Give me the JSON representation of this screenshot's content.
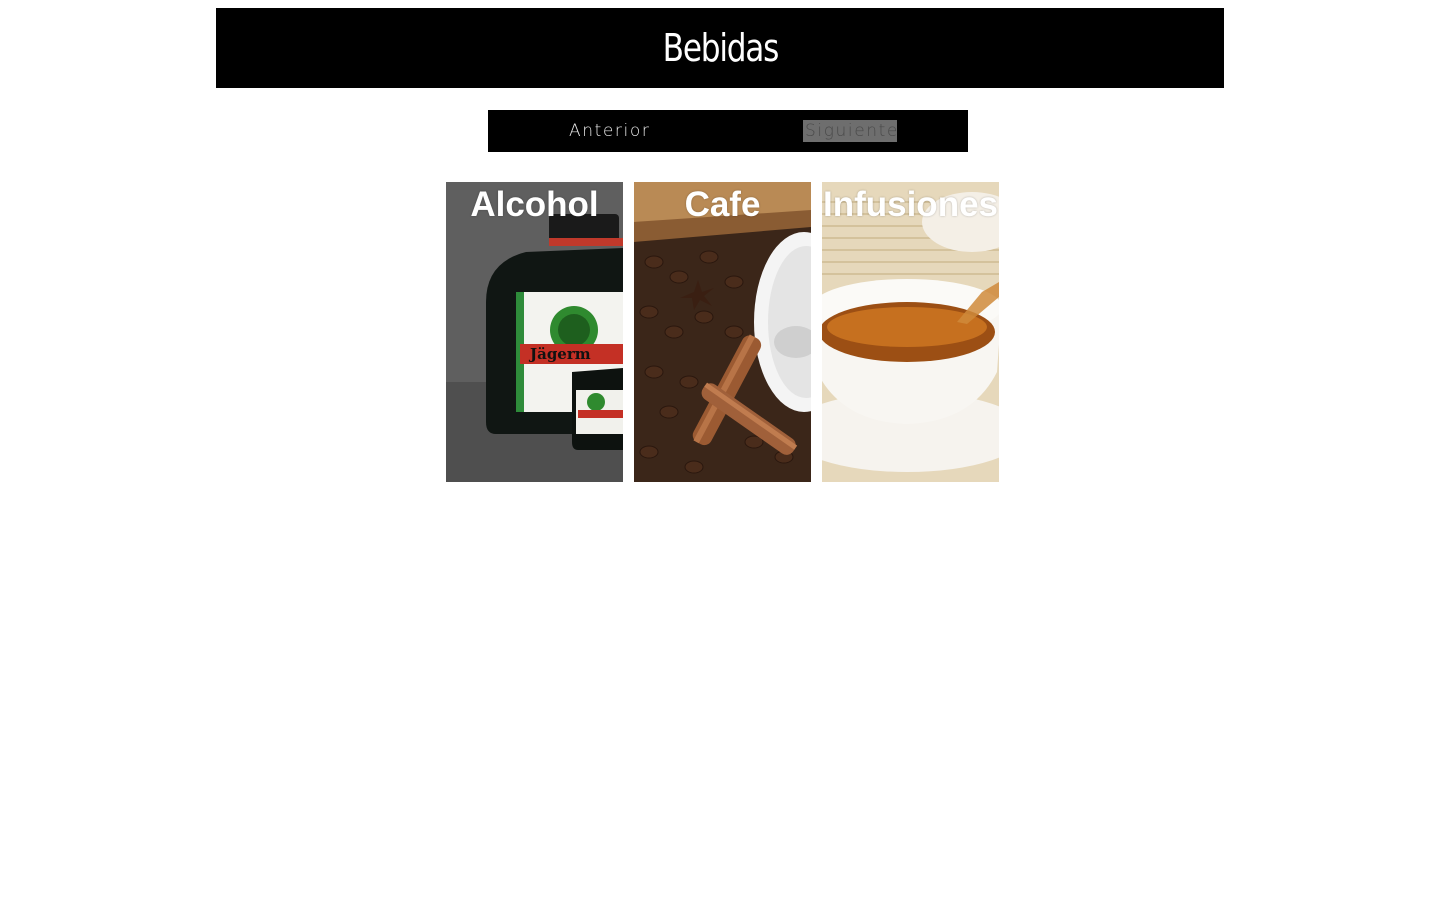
{
  "header": {
    "title": "Bebidas"
  },
  "nav": {
    "prev_label": "Anterior",
    "next_label": "Siguiente"
  },
  "cards": [
    {
      "title": "Alcohol",
      "image": "liquor-bottle-image"
    },
    {
      "title": "Cafe",
      "image": "coffee-beans-image"
    },
    {
      "title": "Infusiones",
      "image": "tea-cup-image"
    }
  ],
  "colors": {
    "header_bg": "#000000",
    "nav_bg": "#000000",
    "title_text": "#ffffff"
  }
}
